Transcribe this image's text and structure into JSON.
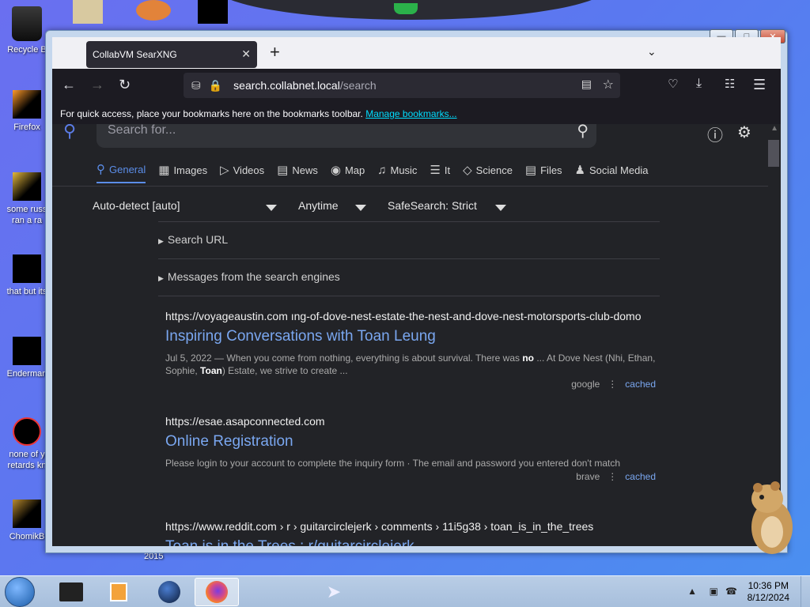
{
  "desktop": {
    "icons": [
      {
        "label": "Recycle B"
      },
      {
        "label": "Firefox"
      },
      {
        "label": "some russ\nran a ra"
      },
      {
        "label": "that but its"
      },
      {
        "label": "Enderman"
      },
      {
        "label": "none of y\nretards kn"
      },
      {
        "label": "ChomikB"
      }
    ],
    "partial_label": "2015"
  },
  "browser": {
    "tab_title": "CollabVM SearXNG",
    "url_host": "search.collabnet.local",
    "url_path": "/search",
    "bookmarks_text": "For quick access, place your bookmarks here on the bookmarks toolbar.",
    "bookmarks_link": "Manage bookmarks..."
  },
  "search": {
    "placeholder": "Search for...",
    "categories": [
      {
        "label": "General",
        "icon": "search-icon",
        "active": true
      },
      {
        "label": "Images",
        "icon": "image-icon"
      },
      {
        "label": "Videos",
        "icon": "play-icon"
      },
      {
        "label": "News",
        "icon": "newspaper-icon"
      },
      {
        "label": "Map",
        "icon": "map-pin-icon"
      },
      {
        "label": "Music",
        "icon": "music-icon"
      },
      {
        "label": "It",
        "icon": "layers-icon"
      },
      {
        "label": "Science",
        "icon": "science-icon"
      },
      {
        "label": "Files",
        "icon": "files-icon"
      },
      {
        "label": "Social Media",
        "icon": "people-icon"
      }
    ],
    "filters": {
      "language": "Auto-detect [auto]",
      "time": "Anytime",
      "safesearch": "SafeSearch: Strict"
    },
    "details": [
      "Search URL",
      "Messages from the search engines"
    ],
    "results": [
      {
        "url": "https://voyageaustin.com  ıng-of-dove-nest-estate-the-nest-and-dove-nest-motorsports-club-domo",
        "title": "Inspiring Conversations with Toan Leung",
        "snippet_a": "Jul 5, 2022 — When you come from nothing, everything is about survival. There was ",
        "snippet_b1": "no",
        "snippet_c": " ... At Dove Nest (Nhi, Ethan, Sophie, ",
        "snippet_b2": "Toan",
        "snippet_d": ") Estate, we strive to create ...",
        "engine": "google",
        "cached": "cached"
      },
      {
        "url": "https://esae.asapconnected.com",
        "title": "Online Registration",
        "snippet": "Please login to your account to complete the inquiry form · The email and password you entered don't match",
        "engine": "brave",
        "cached": "cached"
      },
      {
        "url": "https://www.reddit.com  › r › guitarcirclejerk › comments › 11i5g38 › toan_is_in_the_trees",
        "title": "Toan is in the Trees : r/guitarcirclejerk"
      }
    ]
  },
  "taskbar": {
    "time": "10:36 PM",
    "date": "8/12/2024"
  }
}
